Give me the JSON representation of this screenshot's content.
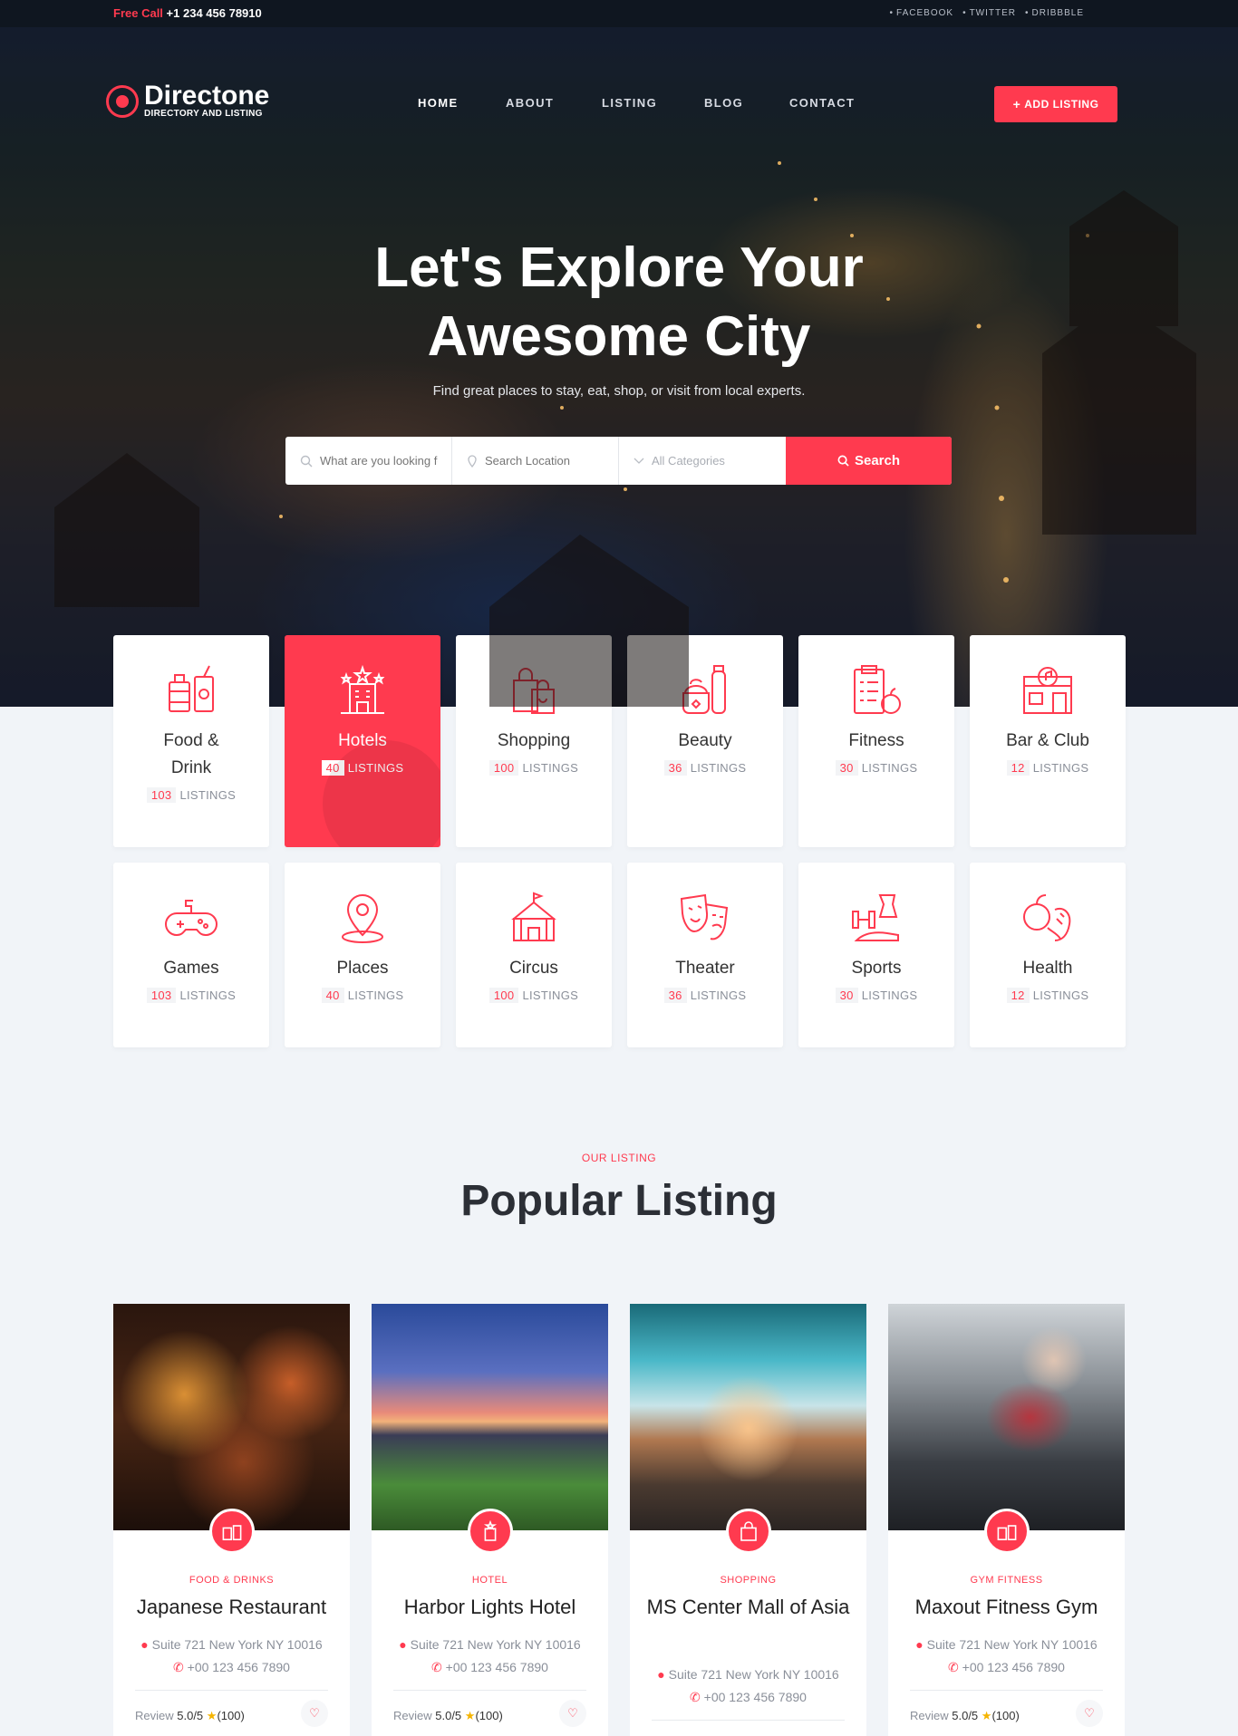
{
  "topbar": {
    "call_label": "Free Call",
    "phone": "+1 234 456 78910",
    "social": [
      "FACEBOOK",
      "TWITTER",
      "DRIBBBLE"
    ]
  },
  "brand": {
    "name": "Directone",
    "tagline": "DIRECTORY AND LISTING"
  },
  "nav": {
    "items": [
      "HOME",
      "ABOUT",
      "LISTING",
      "BLOG",
      "CONTACT"
    ],
    "active": "HOME",
    "add_listing": "ADD LISTING"
  },
  "hero": {
    "title_line1": "Let's Explore Your",
    "title_line2": "Awesome City",
    "subtitle": "Find great places to stay, eat, shop, or visit from local experts.",
    "search": {
      "keyword_placeholder": "What are you looking for?",
      "location_placeholder": "Search Location",
      "category_placeholder": "All Categories",
      "button": "Search"
    }
  },
  "categories": [
    {
      "name": "Food & Drink",
      "count": "103",
      "unit": "LISTINGS",
      "icon": "food-drink-icon"
    },
    {
      "name": "Hotels",
      "count": "40",
      "unit": "LISTINGS",
      "icon": "hotel-icon",
      "active": true
    },
    {
      "name": "Shopping",
      "count": "100",
      "unit": "LISTINGS",
      "icon": "shopping-bag-icon"
    },
    {
      "name": "Beauty",
      "count": "36",
      "unit": "LISTINGS",
      "icon": "beauty-icon"
    },
    {
      "name": "Fitness",
      "count": "30",
      "unit": "LISTINGS",
      "icon": "fitness-icon"
    },
    {
      "name": "Bar & Club",
      "count": "12",
      "unit": "LISTINGS",
      "icon": "bar-club-icon"
    },
    {
      "name": "Games",
      "count": "103",
      "unit": "LISTINGS",
      "icon": "gamepad-icon"
    },
    {
      "name": "Places",
      "count": "40",
      "unit": "LISTINGS",
      "icon": "location-pin-icon"
    },
    {
      "name": "Circus",
      "count": "100",
      "unit": "LISTINGS",
      "icon": "circus-tent-icon"
    },
    {
      "name": "Theater",
      "count": "36",
      "unit": "LISTINGS",
      "icon": "theater-masks-icon"
    },
    {
      "name": "Sports",
      "count": "30",
      "unit": "LISTINGS",
      "icon": "sports-icon"
    },
    {
      "name": "Health",
      "count": "12",
      "unit": "LISTINGS",
      "icon": "health-icon"
    }
  ],
  "popular": {
    "kicker": "OUR LISTING",
    "title": "Popular Listing",
    "listings": [
      {
        "category": "FOOD & DRINKS",
        "name": "Japanese Restaurant",
        "address": "Suite 721 New York NY 10016",
        "phone": "+00 123 456 7890",
        "review_label": "Review",
        "rating": "5.0/5",
        "reviews": "(100)"
      },
      {
        "category": "HOTEL",
        "name": "Harbor Lights Hotel",
        "address": "Suite 721 New York NY 10016",
        "phone": "+00 123 456 7890",
        "review_label": "Review",
        "rating": "5.0/5",
        "reviews": "(100)"
      },
      {
        "category": "SHOPPING",
        "name": "MS Center Mall of Asia",
        "address": "Suite 721 New York NY 10016",
        "phone": "+00 123 456 7890",
        "review_label": "Review",
        "rating": "5.0/5",
        "reviews": "(100)"
      },
      {
        "category": "GYM FITNESS",
        "name": "Maxout Fitness Gym",
        "address": "Suite 721 New York NY 10016",
        "phone": "+00 123 456 7890",
        "review_label": "Review",
        "rating": "5.0/5",
        "reviews": "(100)"
      }
    ]
  },
  "colors": {
    "accent": "#ff3a4f",
    "topbar": "#0f1620",
    "page_bg": "#f1f4f8"
  }
}
